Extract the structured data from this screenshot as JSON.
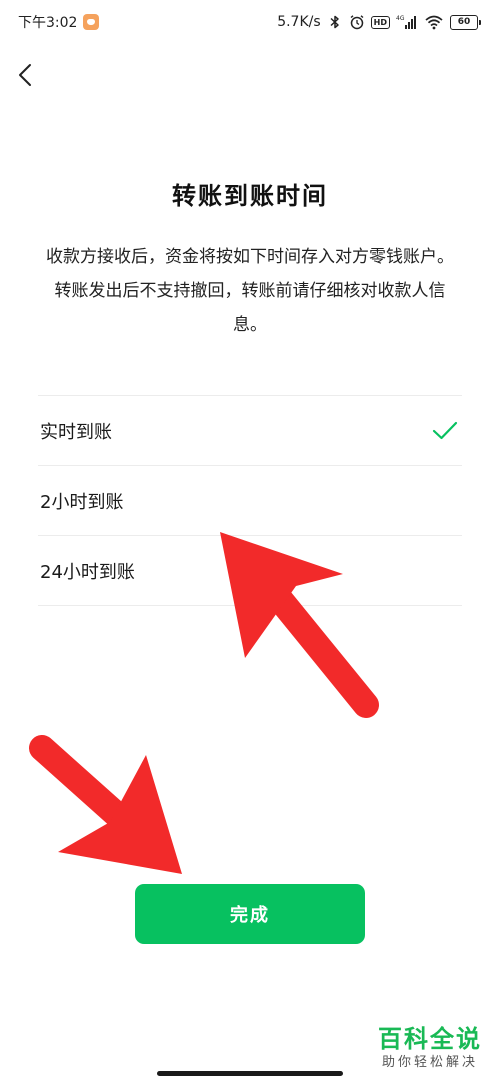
{
  "status_bar": {
    "time": "下午3:02",
    "network_speed": "5.7K/s",
    "battery_level": "60",
    "signal_type": "4G",
    "hd_label": "HD",
    "icons": [
      "app-badge-icon",
      "bluetooth-icon",
      "alarm-icon",
      "hd-icon",
      "signal-icon",
      "wifi-icon",
      "battery-icon"
    ]
  },
  "nav": {
    "back_icon": "chevron-left-icon"
  },
  "page": {
    "title": "转账到账时间",
    "description": "收款方接收后，资金将按如下时间存入对方零钱账户。转账发出后不支持撤回，转账前请仔细核对收款人信息。"
  },
  "options": [
    {
      "label": "实时到账",
      "selected": true
    },
    {
      "label": "2小时到账",
      "selected": false
    },
    {
      "label": "24小时到账",
      "selected": false
    }
  ],
  "done_button": {
    "label": "完成"
  },
  "watermark": {
    "main": "百科全说",
    "sub": "助你轻松解决"
  },
  "colors": {
    "accent_green": "#07c160",
    "check_green": "#07c160",
    "arrow_red": "#f22a2a",
    "watermark_green": "#19b955"
  }
}
